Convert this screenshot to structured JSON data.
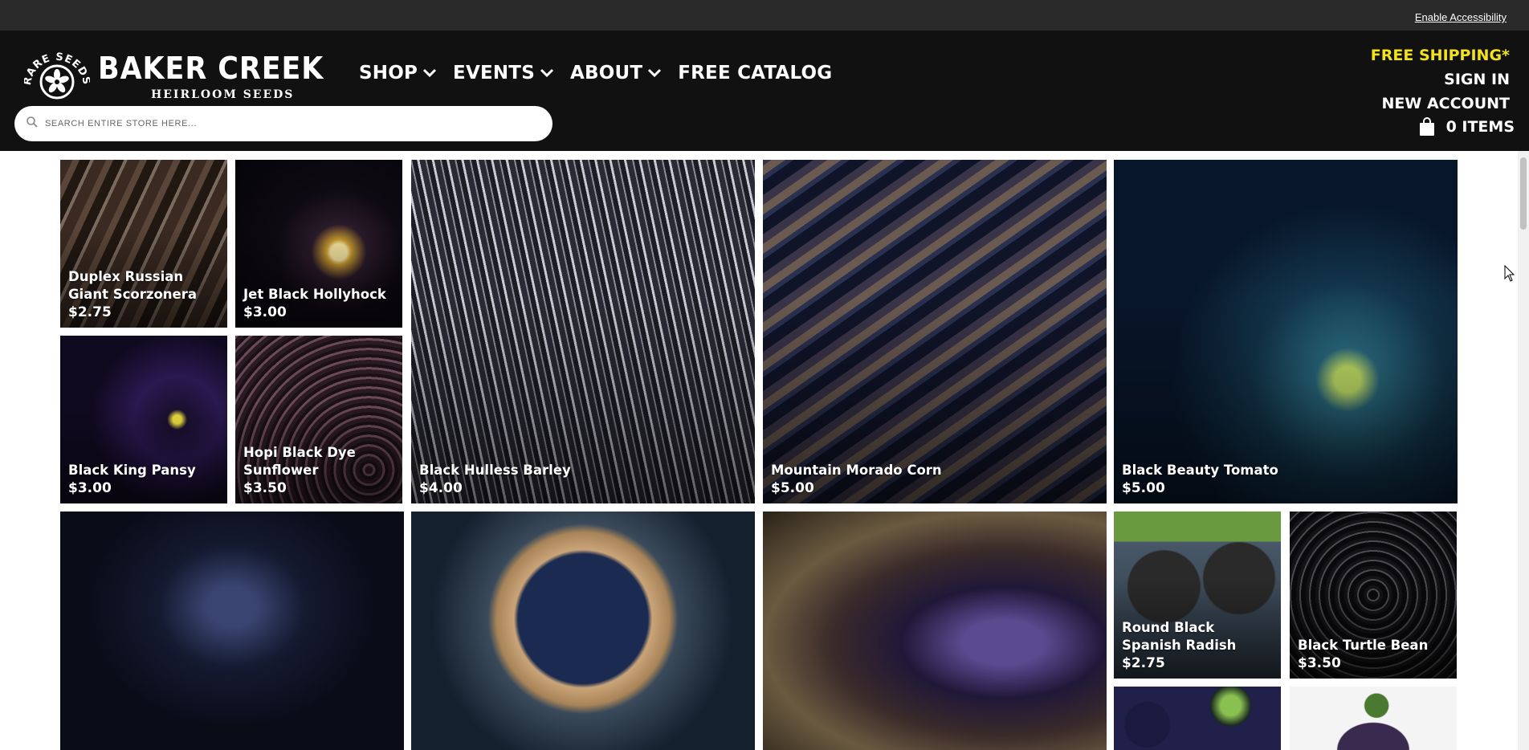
{
  "utility": {
    "accessibility_link": "Enable Accessibility"
  },
  "header": {
    "logo": {
      "badge_text": "RARE SEEDS",
      "name": "BAKER CREEK",
      "tagline": "HEIRLOOM SEEDS"
    },
    "nav": [
      {
        "label": "SHOP",
        "has_dropdown": true
      },
      {
        "label": "EVENTS",
        "has_dropdown": true
      },
      {
        "label": "ABOUT",
        "has_dropdown": true
      },
      {
        "label": "FREE CATALOG",
        "has_dropdown": false
      }
    ],
    "search": {
      "placeholder": "SEARCH ENTIRE STORE HERE...",
      "value": ""
    },
    "links": {
      "free_shipping": "FREE SHIPPING*",
      "sign_in": "SIGN IN",
      "new_account": "NEW ACCOUNT"
    },
    "cart": {
      "label": "0 ITEMS",
      "icon": "shopping-bag-icon"
    }
  },
  "colors": {
    "header_bg": "#111111",
    "util_bg": "#2a2a2a",
    "shipping": "#f3e21a"
  },
  "products": [
    {
      "id": "scorzonera",
      "title": "Duplex Russian Giant Scorzonera",
      "price": "$2.75"
    },
    {
      "id": "hollyhock",
      "title": "Jet Black Hollyhock",
      "price": "$3.00"
    },
    {
      "id": "barley",
      "title": "Black Hulless Barley",
      "price": "$4.00"
    },
    {
      "id": "corn",
      "title": "Mountain Morado Corn",
      "price": "$5.00"
    },
    {
      "id": "tomato",
      "title": "Black Beauty Tomato",
      "price": "$5.00"
    },
    {
      "id": "pansy",
      "title": "Black King Pansy",
      "price": "$3.00"
    },
    {
      "id": "sunflower",
      "title": "Hopi Black Dye Sunflower",
      "price": "$3.50"
    },
    {
      "id": "pepper",
      "title": "",
      "price": ""
    },
    {
      "id": "berries",
      "title": "",
      "price": ""
    },
    {
      "id": "eggplant",
      "title": "",
      "price": ""
    },
    {
      "id": "radish",
      "title": "Round Black Spanish Radish",
      "price": "$2.75"
    },
    {
      "id": "bean",
      "title": "Black Turtle Bean",
      "price": "$3.50"
    },
    {
      "id": "pepper-small",
      "title": "",
      "price": ""
    },
    {
      "id": "eggplant-small",
      "title": "",
      "price": ""
    }
  ]
}
